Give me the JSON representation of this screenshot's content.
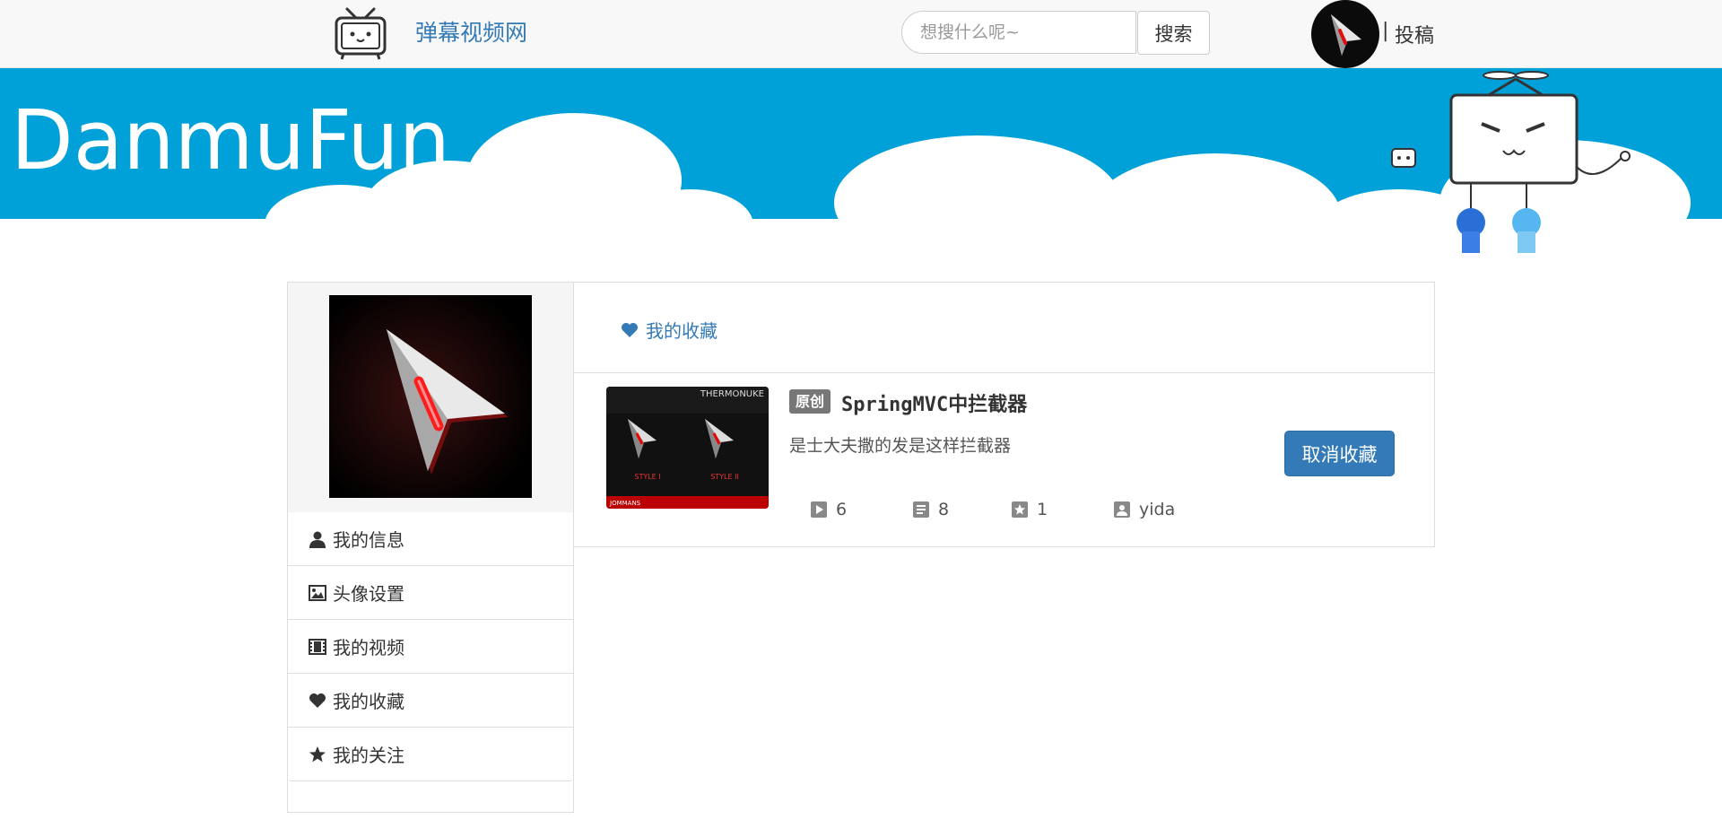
{
  "navbar": {
    "brand": "弹幕视频网",
    "search_placeholder": "想搜什么呢~",
    "search_button": "搜索",
    "separator": "|",
    "submit_label": "投稿"
  },
  "banner": {
    "logo_text": "DanmuFun"
  },
  "sidebar": {
    "menu": [
      {
        "label": "我的信息",
        "icon": "user-icon"
      },
      {
        "label": "头像设置",
        "icon": "picture-icon"
      },
      {
        "label": "我的视频",
        "icon": "film-icon"
      },
      {
        "label": "我的收藏",
        "icon": "heart-icon"
      },
      {
        "label": "我的关注",
        "icon": "star-icon"
      }
    ]
  },
  "main": {
    "tab_label": "我的收藏",
    "video": {
      "badge": "原创",
      "title": "SpringMVC中拦截器",
      "description": "是士大夫撒的发是这样拦截器",
      "thumbnail_brand": "THERMONUKE",
      "thumbnail_style_1": "STYLE I",
      "thumbnail_style_2": "STYLE II",
      "thumbnail_footer": "JOMMANS",
      "stats": {
        "plays": "6",
        "comments": "8",
        "favorites": "1",
        "author": "yida"
      },
      "cancel_button": "取消收藏"
    }
  },
  "colors": {
    "primary": "#337ab7",
    "banner_blue": "#00a0d8",
    "badge_gray": "#777777"
  }
}
